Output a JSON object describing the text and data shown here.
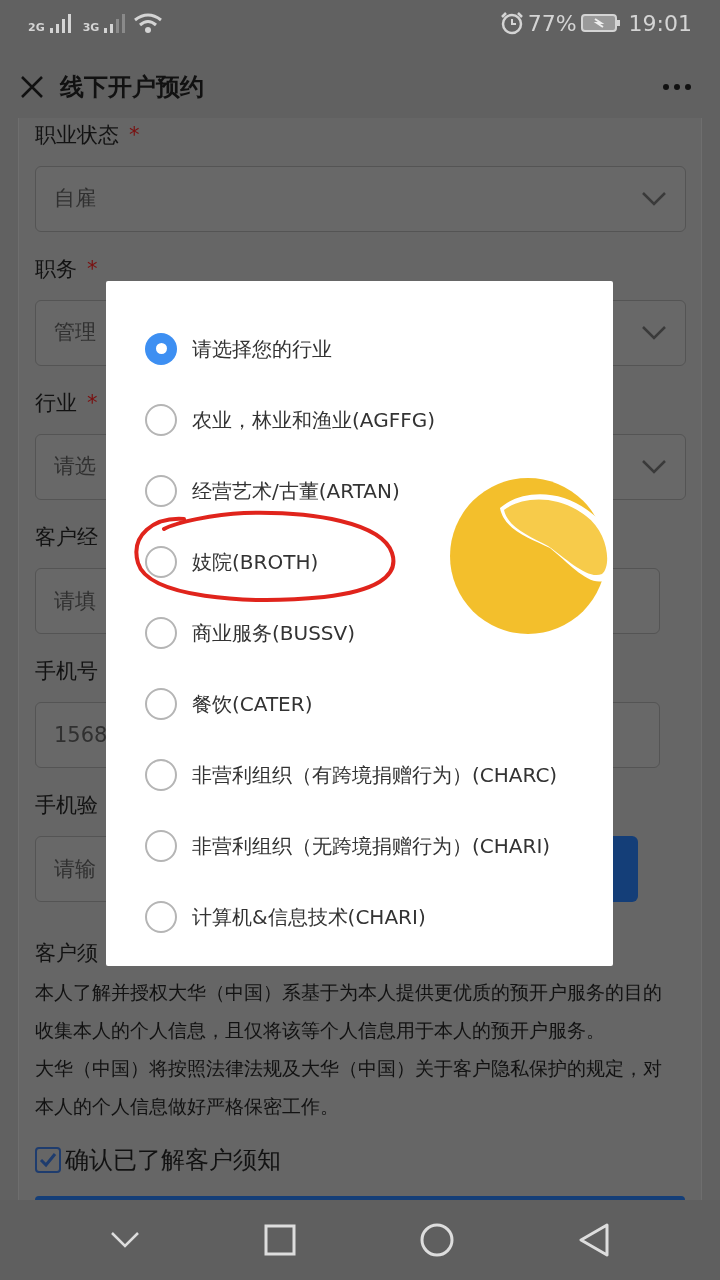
{
  "status_bar": {
    "sim_1": "2G",
    "sim_2": "3G",
    "battery_percent": "77%",
    "time": "19:01"
  },
  "header": {
    "title": "线下开户预约"
  },
  "form": {
    "fields": [
      {
        "label": "职业状态",
        "required_mark": "*",
        "kind": "select",
        "value": "自雇"
      },
      {
        "label": "职务",
        "required_mark": "*",
        "kind": "select",
        "value": "管理"
      },
      {
        "label": "行业",
        "required_mark": "*",
        "kind": "select",
        "placeholder": "请选"
      },
      {
        "label": "客户经",
        "kind": "input",
        "placeholder": "请填"
      },
      {
        "label": "手机号",
        "kind": "input",
        "value": "1568"
      },
      {
        "label": "手机验",
        "kind": "input_button",
        "placeholder": "请输"
      }
    ],
    "notice": {
      "title": "客户须",
      "paragraphs": [
        "本人了解并授权大华（中国）系基于为本人提供更优质的预开户服务的目的收集本人的个人信息，且仅将该等个人信息用于本人的预开户服务。",
        "大华（中国）将按照法律法规及大华（中国）关于客户隐私保护的规定，对本人的个人信息做好严格保密工作。"
      ]
    },
    "consent": {
      "label": "确认已了解客户须知",
      "checked": true
    }
  },
  "modal": {
    "options": [
      {
        "label": "请选择您的行业",
        "selected": true
      },
      {
        "label": "农业，林业和渔业(AGFFG)",
        "selected": false
      },
      {
        "label": "经营艺术/古董(ARTAN)",
        "selected": false
      },
      {
        "label": "妓院(BROTH)",
        "selected": false
      },
      {
        "label": "商业服务(BUSSV)",
        "selected": false
      },
      {
        "label": "餐饮(CATER)",
        "selected": false
      },
      {
        "label": "非营利组织（有跨境捐赠行为）(CHARC)",
        "selected": false
      },
      {
        "label": "非营利组织（无跨境捐赠行为）(CHARI)",
        "selected": false
      },
      {
        "label": "计算机&信息技术(CHARI)",
        "selected": false
      }
    ]
  }
}
